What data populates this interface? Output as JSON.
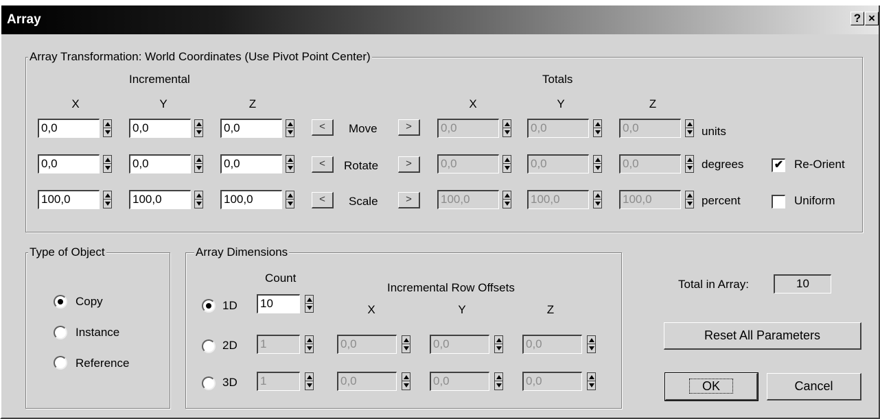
{
  "window": {
    "title": "Array",
    "help_glyph": "?",
    "close_glyph": "×"
  },
  "transform": {
    "group_title": "Array Transformation: World Coordinates (Use Pivot Point Center)",
    "incremental_label": "Incremental",
    "totals_label": "Totals",
    "axis": {
      "x": "X",
      "y": "Y",
      "z": "Z"
    },
    "rows": [
      {
        "label": "Move",
        "inc": [
          "0,0",
          "0,0",
          "0,0"
        ],
        "tot": [
          "0,0",
          "0,0",
          "0,0"
        ],
        "unit": "units"
      },
      {
        "label": "Rotate",
        "inc": [
          "0,0",
          "0,0",
          "0,0"
        ],
        "tot": [
          "0,0",
          "0,0",
          "0,0"
        ],
        "unit": "degrees"
      },
      {
        "label": "Scale",
        "inc": [
          "100,0",
          "100,0",
          "100,0"
        ],
        "tot": [
          "100,0",
          "100,0",
          "100,0"
        ],
        "unit": "percent"
      }
    ],
    "left_arrow": "<",
    "right_arrow": ">",
    "reorient": {
      "label": "Re-Orient",
      "checked": true,
      "mark": "✔"
    },
    "uniform": {
      "label": "Uniform",
      "checked": false
    }
  },
  "type_of_object": {
    "group_title": "Type of Object",
    "options": [
      {
        "label": "Copy",
        "selected": true
      },
      {
        "label": "Instance",
        "selected": false
      },
      {
        "label": "Reference",
        "selected": false
      }
    ]
  },
  "dimensions": {
    "group_title": "Array Dimensions",
    "count_label": "Count",
    "offsets_label": "Incremental Row Offsets",
    "axis": {
      "x": "X",
      "y": "Y",
      "z": "Z"
    },
    "rows": [
      {
        "label": "1D",
        "selected": true,
        "count": "10"
      },
      {
        "label": "2D",
        "selected": false,
        "count": "1",
        "offsets": [
          "0,0",
          "0,0",
          "0,0"
        ]
      },
      {
        "label": "3D",
        "selected": false,
        "count": "1",
        "offsets": [
          "0,0",
          "0,0",
          "0,0"
        ]
      }
    ]
  },
  "total": {
    "label": "Total in Array:",
    "value": "10"
  },
  "buttons": {
    "reset": "Reset All Parameters",
    "ok": "OK",
    "cancel": "Cancel"
  }
}
